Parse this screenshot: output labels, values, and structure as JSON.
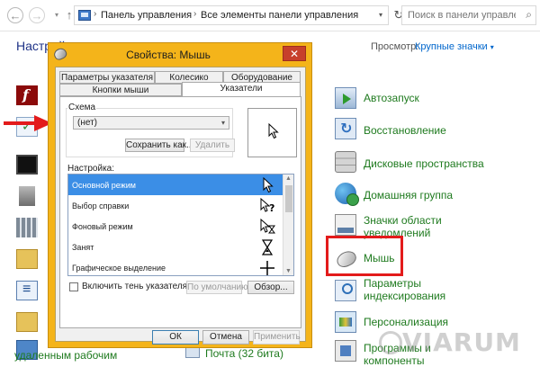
{
  "addressbar": {
    "back_glyph": "←",
    "forward_glyph": "→",
    "dropdown_glyph": "▾",
    "up_glyph": "↑",
    "crumbs": [
      "Панель управления",
      "Все элементы панели управления"
    ],
    "separator": "›",
    "refresh_glyph": "↻",
    "search_placeholder": "Поиск в панели управления",
    "search_icon": "⌕"
  },
  "control_panel": {
    "heading": "Настрой",
    "view_label": "Просмотр:",
    "view_value": "Крупные значки",
    "right_items": [
      {
        "label": "Автозапуск",
        "icon": "autorun-icon"
      },
      {
        "label": "Восстановление",
        "icon": "restore-icon"
      },
      {
        "label": "Дисковые пространства",
        "icon": "disk-icon"
      },
      {
        "label": "Домашняя группа",
        "icon": "homegroup-icon"
      },
      {
        "label": "Значки области уведомлений",
        "icon": "tray-icon"
      },
      {
        "label": "Мышь",
        "icon": "mouse-icon"
      },
      {
        "label": "Параметры индексирования",
        "icon": "index-icon"
      },
      {
        "label": "Персонализация",
        "icon": "personalization-icon"
      },
      {
        "label": "Программы и компоненты",
        "icon": "programs-icon"
      }
    ],
    "bottom_left_text": "удаленным рабочим",
    "bottom_mid_text": "Почта (32 бита)"
  },
  "dialog": {
    "title": "Свойства: Мышь",
    "close_glyph": "✕",
    "tabs_row1": [
      "Параметры указателя",
      "Колесико",
      "Оборудование"
    ],
    "tabs_row2": [
      "Кнопки мыши",
      "Указатели"
    ],
    "active_tab": "Указатели",
    "scheme_label": "Схема",
    "scheme_value": "(нет)",
    "save_as_label": "Сохранить как...",
    "delete_label": "Удалить",
    "settings_label": "Настройка:",
    "cursors": [
      {
        "name": "Основной режим",
        "glyph": "arrow",
        "selected": true
      },
      {
        "name": "Выбор справки",
        "glyph": "help",
        "selected": false
      },
      {
        "name": "Фоновый режим",
        "glyph": "working",
        "selected": false
      },
      {
        "name": "Занят",
        "glyph": "busy",
        "selected": false
      },
      {
        "name": "Графическое выделение",
        "glyph": "cross",
        "selected": false
      }
    ],
    "shadow_checkbox_label": "Включить тень указателя",
    "shadow_checked": false,
    "default_label": "По умолчанию",
    "browse_label": "Обзор...",
    "ok_label": "ОК",
    "cancel_label": "Отмена",
    "apply_label": "Применить"
  },
  "watermark": "VIARUM",
  "colors": {
    "dialog_frame": "#f4b41a",
    "highlight_red": "#e31b1b",
    "link_green": "#1e7a1e",
    "selection_blue": "#3b8ee6"
  }
}
